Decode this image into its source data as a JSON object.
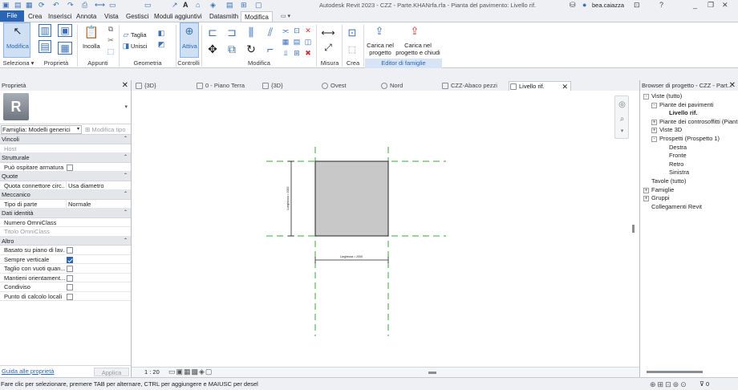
{
  "titlebar": {
    "title": "Autodesk Revit 2023 - CZZ - Parte.KHANrfa.rfa - Pianta del pavimento: Livello rif.",
    "user": "bea.caiazza",
    "help": "?"
  },
  "ribbon_tabs": [
    "File",
    "Crea",
    "Inserisci",
    "Annota",
    "Vista",
    "Gestisci",
    "Moduli aggiuntivi",
    "Datasmith",
    "Modifica"
  ],
  "ribbon": {
    "modify_label": "Modifica",
    "paste_label": "Incolla",
    "cut_label": "Taglia",
    "join_label": "Unisci",
    "activate_label": "Attiva",
    "load_project_label": "Carica nel progetto",
    "load_close_label": "Carica nel progetto e chiudi",
    "panels": [
      "Seleziona",
      "Proprietà",
      "Appunti",
      "Geometria",
      "Controlli",
      "Modifica",
      "Misura",
      "Crea",
      "Editor di famiglie"
    ]
  },
  "properties": {
    "header": "Proprietà",
    "family_selector": "Famiglia: Modelli generici",
    "edit_type": "Modifica tipo",
    "categories": [
      {
        "name": "Vincoli",
        "rows": [
          {
            "label": "Host",
            "value": "",
            "grey": true
          }
        ]
      },
      {
        "name": "Strutturale",
        "rows": [
          {
            "label": "Può ospitare armatura",
            "check": false
          }
        ]
      },
      {
        "name": "Quote",
        "rows": [
          {
            "label": "Quota connettore circ...",
            "value": "Usa diametro"
          }
        ]
      },
      {
        "name": "Meccanico",
        "rows": [
          {
            "label": "Tipo di parte",
            "value": "Normale"
          }
        ]
      },
      {
        "name": "Dati identità",
        "rows": [
          {
            "label": "Numero OmniClass",
            "value": ""
          },
          {
            "label": "Titolo OmniClass",
            "value": "",
            "grey": true
          }
        ]
      },
      {
        "name": "Altro",
        "rows": [
          {
            "label": "Basato su piano di lav...",
            "check": false
          },
          {
            "label": "Sempre verticale",
            "check": true
          },
          {
            "label": "Taglio con vuoti quan...",
            "check": false
          },
          {
            "label": "Mantieni orientament...",
            "check": false
          },
          {
            "label": "Condiviso",
            "check": false
          },
          {
            "label": "Punto di calcolo locali",
            "check": false
          }
        ]
      }
    ],
    "help_link": "Guida alle proprietà",
    "apply": "Applica"
  },
  "view_tabs": [
    "{3D}",
    "0 - Piano Terra",
    "{3D}",
    "Ovest",
    "Nord",
    "CZZ-Abaco pezzi",
    "Livello rif."
  ],
  "view_bar": {
    "scale": "1 : 20"
  },
  "browser": {
    "header": "Browser di progetto - CZZ - Part...",
    "items": [
      {
        "label": "Viste (tutto)",
        "level": 0,
        "toggle": "-"
      },
      {
        "label": "Piante dei pavimenti",
        "level": 1,
        "toggle": "-"
      },
      {
        "label": "Livello rif.",
        "level": 2,
        "bold": true
      },
      {
        "label": "Piante dei controsoffitti (Piant",
        "level": 1,
        "toggle": "+"
      },
      {
        "label": "Viste 3D",
        "level": 1,
        "toggle": "+"
      },
      {
        "label": "Prospetti (Prospetto 1)",
        "level": 1,
        "toggle": "-"
      },
      {
        "label": "Destra",
        "level": 2
      },
      {
        "label": "Fronte",
        "level": 2
      },
      {
        "label": "Retro",
        "level": 2
      },
      {
        "label": "Sinistra",
        "level": 2
      },
      {
        "label": "Tavole (tutto)",
        "level": 0
      },
      {
        "label": "Famiglie",
        "level": 0,
        "toggle": "+"
      },
      {
        "label": "Gruppi",
        "level": 0,
        "toggle": "+"
      },
      {
        "label": "Collegamenti Revit",
        "level": 0
      }
    ]
  },
  "drawing": {
    "dim_vertical": "Lunghezza = 2000",
    "dim_horizontal": "Larghezza = 2000"
  },
  "status": {
    "text": "Fare clic per selezionare, premere TAB per alternare, CTRL per aggiungere e MAIUSC per desel",
    "filter": "0"
  },
  "colors": {
    "accent": "#2a64b5",
    "refplane": "#3aa53a",
    "element_fill": "#c8c8c8"
  }
}
